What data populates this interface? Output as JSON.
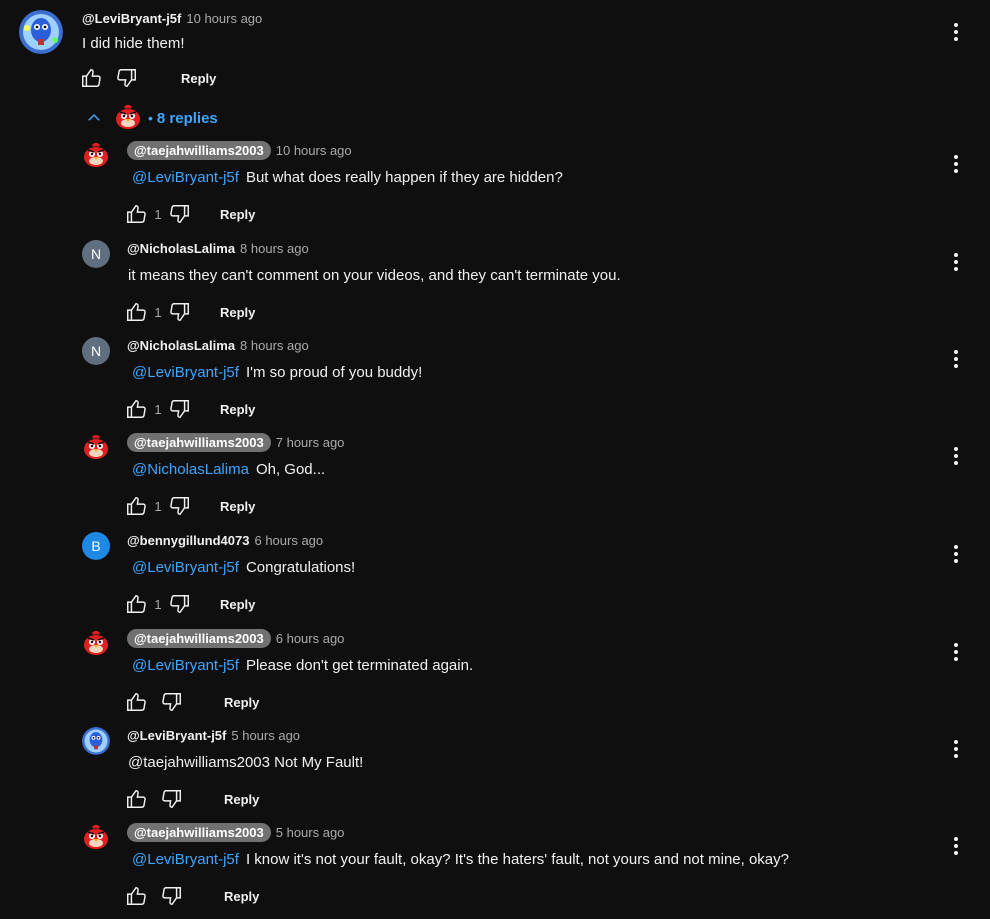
{
  "colors": {
    "background": "#0f0f0f",
    "text": "#f1f1f1",
    "secondary": "#aaaaaa",
    "link": "#3ea6ff",
    "pill": "#717171"
  },
  "parent": {
    "author": "@LeviBryant-j5f",
    "time": "10 hours ago",
    "text": "I did hide them!",
    "reply_label": "Reply",
    "avatar_icon": "blue-character-avatar"
  },
  "replies_toggle": {
    "count_label": "8 replies",
    "dot": "•"
  },
  "replies": [
    {
      "author": "@taejahwilliams2003",
      "pill": true,
      "time": "10 hours ago",
      "mention": "@LeviBryant-j5f",
      "text": "But what does really happen if they are hidden?",
      "likes": "1",
      "reply_label": "Reply",
      "avatar": "red-bird-avatar"
    },
    {
      "author": "@NicholasLalima",
      "pill": false,
      "time": "8 hours ago",
      "mention": "",
      "text": "it means they can't comment on your videos, and they can't terminate you.",
      "likes": "1",
      "reply_label": "Reply",
      "avatar": "letter",
      "letter": "N",
      "avatar_color": "#5f6f7f"
    },
    {
      "author": "@NicholasLalima",
      "pill": false,
      "time": "8 hours ago",
      "mention": "@LeviBryant-j5f",
      "text": "I'm so proud of you buddy!",
      "likes": "1",
      "reply_label": "Reply",
      "avatar": "letter",
      "letter": "N",
      "avatar_color": "#5f6f7f"
    },
    {
      "author": "@taejahwilliams2003",
      "pill": true,
      "time": "7 hours ago",
      "mention": "@NicholasLalima",
      "text": "Oh, God...",
      "likes": "1",
      "reply_label": "Reply",
      "avatar": "red-bird-avatar"
    },
    {
      "author": "@bennygillund4073",
      "pill": false,
      "time": "6 hours ago",
      "mention": "@LeviBryant-j5f",
      "text": "Congratulations!",
      "likes": "1",
      "reply_label": "Reply",
      "avatar": "letter",
      "letter": "B",
      "avatar_color": "#1e88e5"
    },
    {
      "author": "@taejahwilliams2003",
      "pill": true,
      "time": "6 hours ago",
      "mention": "@LeviBryant-j5f",
      "text": "Please don't get terminated again.",
      "likes": "",
      "reply_label": "Reply",
      "avatar": "red-bird-avatar"
    },
    {
      "author": "@LeviBryant-j5f",
      "pill": false,
      "time": "5 hours ago",
      "mention": "",
      "text": "@taejahwilliams2003 Not My Fault!",
      "likes": "",
      "reply_label": "Reply",
      "avatar": "blue-character-avatar"
    },
    {
      "author": "@taejahwilliams2003",
      "pill": true,
      "time": "5 hours ago",
      "mention": "@LeviBryant-j5f",
      "text": "I know it's not your fault, okay? It's the haters' fault, not yours and not mine, okay?",
      "likes": "",
      "reply_label": "Reply",
      "avatar": "red-bird-avatar"
    }
  ]
}
